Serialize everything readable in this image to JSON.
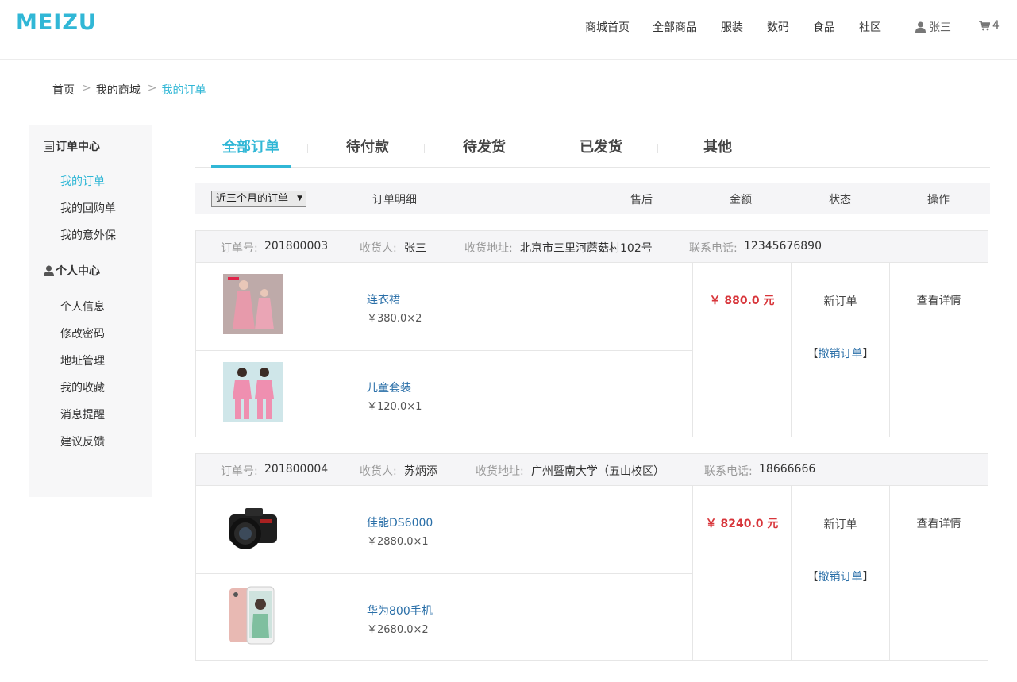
{
  "brand": {
    "logo_text": "MEIZU",
    "accent": "#31b7d6"
  },
  "nav": [
    "商城首页",
    "全部商品",
    "服装",
    "数码",
    "食品",
    "社区"
  ],
  "user": {
    "name": "张三",
    "icon": "user-icon"
  },
  "cart": {
    "count": "4",
    "icon": "cart-icon"
  },
  "breadcrumb": {
    "home": "首页",
    "mall": "我的商城",
    "current": "我的订单",
    "sep": ">"
  },
  "sidebar": {
    "order_center": "订单中心",
    "order_items": [
      "我的订单",
      "我的回购单",
      "我的意外保"
    ],
    "personal_center": "个人中心",
    "personal_items": [
      "个人信息",
      "修改密码",
      "地址管理",
      "我的收藏",
      "消息提醒",
      "建议反馈"
    ]
  },
  "tabs": [
    "全部订单",
    "待付款",
    "待发货",
    "已发货",
    "其他"
  ],
  "table_header": {
    "range": "近三个月的订单",
    "detail": "订单明细",
    "after_sale": "售后",
    "amount": "金额",
    "status": "状态",
    "action": "操作"
  },
  "labels": {
    "order_no": "订单号:",
    "receiver": "收货人:",
    "address": "收货地址:",
    "phone": "联系电话:"
  },
  "orders": [
    {
      "order_no": "201800003",
      "receiver": "张三",
      "address": "北京市三里河蘑菇村102号",
      "phone": "12345676890",
      "items": [
        {
          "name": "连衣裙",
          "price": "￥380.0×2",
          "thumb": "dress-photo"
        },
        {
          "name": "儿童套装",
          "price": "￥120.0×1",
          "thumb": "kids-suit-photo"
        }
      ],
      "amount": "￥ 880.0 元",
      "status": "新订单",
      "cancel": "撤销订单",
      "detail": "查看详情"
    },
    {
      "order_no": "201800004",
      "receiver": "苏炳添",
      "address": "广州暨南大学（五山校区）",
      "phone": "18666666",
      "items": [
        {
          "name": "佳能DS6000",
          "price": "￥2880.0×1",
          "thumb": "camera-photo"
        },
        {
          "name": "华为800手机",
          "price": "￥2680.0×2",
          "thumb": "phone-photo"
        }
      ],
      "amount": "￥ 8240.0 元",
      "status": "新订单",
      "cancel": "撤销订单",
      "detail": "查看详情"
    }
  ]
}
